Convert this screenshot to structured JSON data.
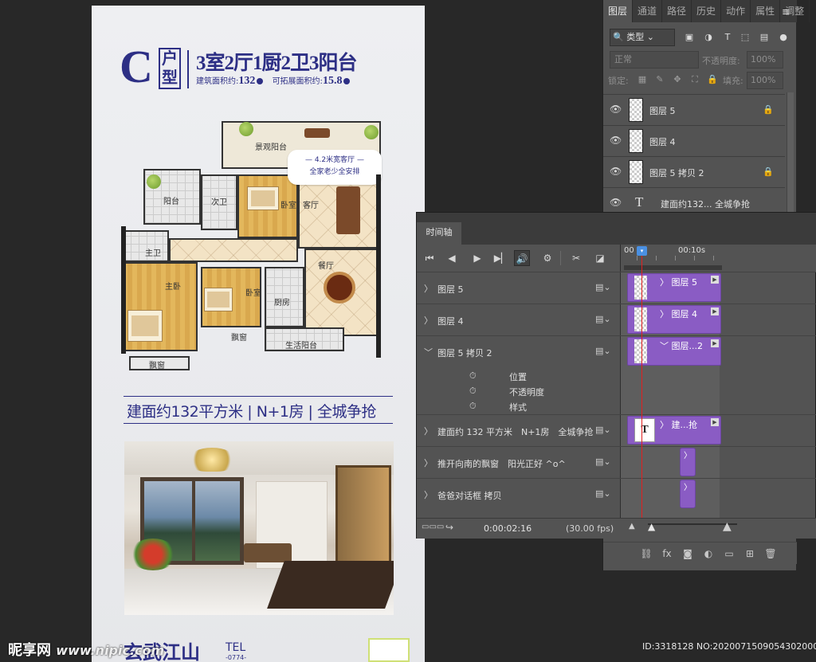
{
  "canvas": {
    "type_letter": "C",
    "type_label": "户型",
    "rooms_title": "3室2厅1厨2卫3阳台",
    "area_label": "建筑面积约:",
    "area_value": "132",
    "ext_area_label": "可拓展面积约:",
    "ext_area_value": "15.8",
    "bubble_line1": "— 4.2米宽客厅 —",
    "bubble_line2": "全家老少全安排",
    "rooms": {
      "view_balcony": "景观阳台",
      "balcony": "阳台",
      "second_bath": "次卫",
      "second_bedroom": "卧室",
      "living": "客厅",
      "master_bath": "主卫",
      "master_bedroom": "主卧",
      "bedroom": "卧室",
      "dining": "餐厅",
      "kitchen": "厨房",
      "bay_window": "飘窗",
      "bay_window2": "飘窗",
      "service_balcony": "生活阳台"
    },
    "slogan": "建面约132平方米 | N+1房 | 全城争抢",
    "footer_logo": "玄武江山",
    "footer_tel": "TEL",
    "footer_tel_sub": "-0774-"
  },
  "layers_panel": {
    "tabs": [
      "图层",
      "通道",
      "路径",
      "历史",
      "动作",
      "属性",
      "调整"
    ],
    "kind_filter": "类型",
    "blend_mode": "正常",
    "opacity_label": "不透明度:",
    "opacity_value": "100%",
    "lock_label": "锁定:",
    "fill_label": "填充:",
    "fill_value": "100%",
    "layers": [
      {
        "name": "图层 5",
        "locked": true
      },
      {
        "name": "图层 4",
        "locked": false
      },
      {
        "name": "图层 5 拷贝 2",
        "locked": true
      },
      {
        "name": "建面约132... 全城争抢",
        "locked": false
      }
    ]
  },
  "timeline": {
    "title": "时间轴",
    "ruler_start": "00",
    "ruler_mark": "00:10s",
    "tracks": [
      {
        "name": "图层 5",
        "clip": "图层 5"
      },
      {
        "name": "图层 4",
        "clip": "图层 4"
      },
      {
        "name": "图层 5 拷贝 2",
        "clip": "图层...2"
      },
      {
        "name": "建面约 132 平方米　N+1房　全城争抢",
        "clip": "建...抢"
      },
      {
        "name": "推开向南的飘窗　阳光正好 ^o^",
        "clip": ""
      },
      {
        "name": "爸爸对话框 拷贝",
        "clip": ""
      }
    ],
    "properties": [
      "位置",
      "不透明度",
      "样式"
    ],
    "timecode": "0:00:02:16",
    "fps": "(30.00 fps)"
  },
  "watermark": {
    "brand": "昵享网",
    "site": "www.nipic.com"
  },
  "id_info": "ID:3318128 NO:20200715090543020000"
}
